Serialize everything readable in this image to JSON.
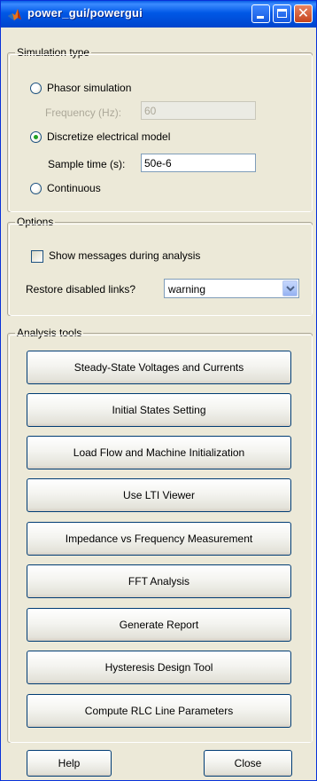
{
  "window": {
    "title": "power_gui/powergui"
  },
  "simulation_type": {
    "legend": "Simulation type",
    "phasor_label": "Phasor simulation",
    "frequency_label": "Frequency (Hz):",
    "frequency_value": "60",
    "discrete_label": "Discretize electrical  model",
    "sample_time_label": "Sample time (s):",
    "sample_time_value": "50e-6",
    "continuous_label": "Continuous",
    "selected": "discrete"
  },
  "options": {
    "legend": "Options",
    "show_messages_label": "Show messages during analysis",
    "show_messages_checked": false,
    "restore_links_label": "Restore disabled links?",
    "restore_links_value": "warning"
  },
  "analysis_tools": {
    "legend": "Analysis tools",
    "buttons": [
      "Steady-State Voltages and Currents",
      "Initial States Setting",
      "Load Flow and Machine Initialization",
      "Use LTI Viewer",
      "Impedance vs Frequency Measurement",
      "FFT Analysis",
      "Generate Report",
      "Hysteresis Design Tool",
      "Compute RLC  Line Parameters"
    ]
  },
  "footer": {
    "help_label": "Help",
    "close_label": "Close"
  },
  "colors": {
    "titlebar": "#0058e6",
    "dialog_bg": "#ece9d8",
    "radio_dot": "#21a121",
    "button_border": "#003c74"
  },
  "icons": {
    "app": "matlab-logo-icon",
    "minimize": "minimize-icon",
    "maximize": "maximize-icon",
    "close": "close-icon",
    "dropdown": "chevron-down-icon"
  }
}
